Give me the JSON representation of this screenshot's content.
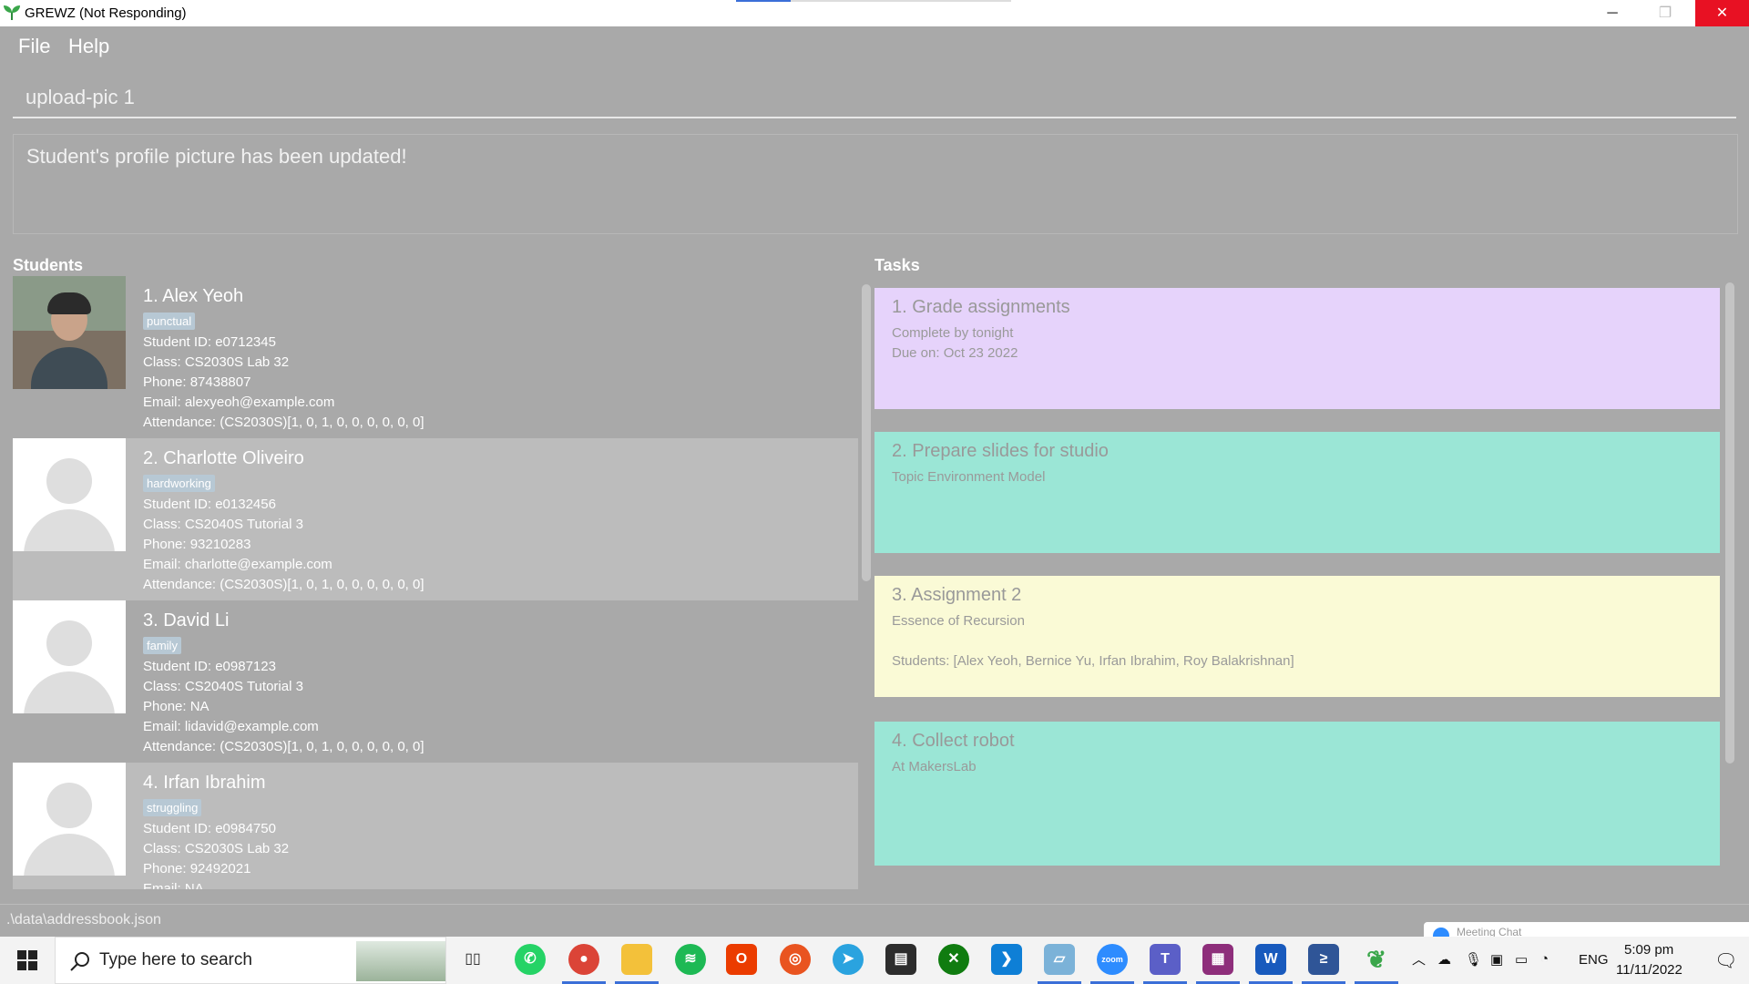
{
  "window": {
    "title": "GREWZ (Not Responding)",
    "minimize": "─",
    "maximize": "❐",
    "close": "✕"
  },
  "menu": {
    "file": "File",
    "help": "Help"
  },
  "command": {
    "value": "upload-pic 1"
  },
  "result": {
    "message": "Student's profile picture has been updated!"
  },
  "students": {
    "title": "Students",
    "items": [
      {
        "name": "1.  Alex Yeoh",
        "tag": "punctual",
        "id": "Student ID: e0712345",
        "class": "Class: CS2030S Lab 32",
        "phone": "Phone: 87438807",
        "email": "Email: alexyeoh@example.com",
        "attendance": "Attendance: (CS2030S)[1, 0, 1, 0, 0, 0, 0, 0, 0]"
      },
      {
        "name": "2.  Charlotte Oliveiro",
        "tag": "hardworking",
        "id": "Student ID: e0132456",
        "class": "Class: CS2040S Tutorial 3",
        "phone": "Phone: 93210283",
        "email": "Email: charlotte@example.com",
        "attendance": "Attendance: (CS2030S)[1, 0, 1, 0, 0, 0, 0, 0, 0]"
      },
      {
        "name": "3.  David Li",
        "tag": "family",
        "id": "Student ID: e0987123",
        "class": "Class: CS2040S Tutorial 3",
        "phone": "Phone: NA",
        "email": "Email: lidavid@example.com",
        "attendance": "Attendance: (CS2030S)[1, 0, 1, 0, 0, 0, 0, 0, 0]"
      },
      {
        "name": "4.  Irfan Ibrahim",
        "tag": "struggling",
        "id": "Student ID: e0984750",
        "class": "Class: CS2030S Lab 32",
        "phone": "Phone: 92492021",
        "email": "Email: NA"
      }
    ]
  },
  "tasks": {
    "title": "Tasks",
    "items": [
      {
        "name": "1.  Grade assignments",
        "line1": "Complete by tonight",
        "line2": "Due on: Oct 23 2022",
        "color": "#e6d3fb"
      },
      {
        "name": "2.  Prepare slides for studio",
        "line1": "Topic Environment Model",
        "color": "#9be6d6"
      },
      {
        "name": "3.  Assignment 2",
        "line1": "Essence of Recursion",
        "line2": "Students: [Alex Yeoh, Bernice Yu, Irfan Ibrahim, Roy Balakrishnan]",
        "color": "#fafad6"
      },
      {
        "name": "4.  Collect robot",
        "line1": "At MakersLab",
        "color": "#9be6d6"
      }
    ]
  },
  "status": {
    "path": ".\\data\\addressbook.json",
    "meeting": "Meeting Chat"
  },
  "taskbar": {
    "search_placeholder": "Type here to search",
    "apps": [
      "taskview-icon",
      "whatsapp-icon",
      "chrome-icon",
      "file-explorer-icon",
      "spotify-icon",
      "office-icon",
      "ubuntu-icon",
      "telegram-icon",
      "terminal-icon",
      "xbox-icon",
      "vscode-icon",
      "notes-icon",
      "zoom-icon",
      "teams-icon",
      "winrar-icon",
      "word-icon",
      "powershell-icon",
      "grewz-icon"
    ],
    "lang": "ENG",
    "time": "5:09 pm",
    "date": "11/11/2022"
  }
}
